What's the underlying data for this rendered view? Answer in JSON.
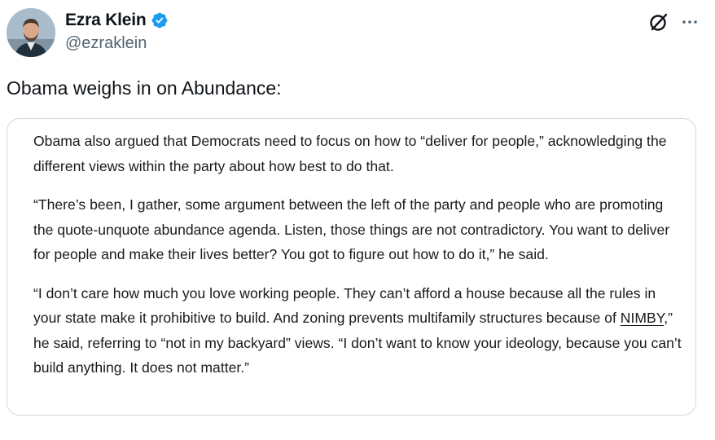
{
  "author": {
    "display_name": "Ezra Klein",
    "handle": "@ezraklein",
    "verified": true,
    "avatar_icon": "profile-photo"
  },
  "actions": {
    "grok_icon": "grok-slash-circle-icon",
    "more_icon": "more-horizontal-icon"
  },
  "tweet": {
    "text": "Obama weighs in on Abundance:"
  },
  "quoted_article": {
    "paragraph_1": "Obama also argued that Democrats need to focus on how to “deliver for people,” acknowledging the different views within the party about how best to do that.",
    "paragraph_2": "“There’s been, I gather, some argument between the left of the party and people who are promoting the quote-unquote abundance agenda. Listen, those things are not contradictory. You want to deliver for people and make their lives better? You got to figure out how to do it,” he said.",
    "paragraph_3_before": "“I don’t care how much you love working people. They can’t afford a house because all the rules in your state make it prohibitive to build. And zoning prevents multifamily structures because of ",
    "paragraph_3_link": "NIMBY",
    "paragraph_3_after": ",” he said, referring to “not in my backyard” views. “I don’t want to know your ideology, because you can’t build anything. It does not matter.”"
  },
  "colors": {
    "verified_blue": "#1d9bf0",
    "secondary_text": "#536471",
    "border": "#cfd9de"
  }
}
